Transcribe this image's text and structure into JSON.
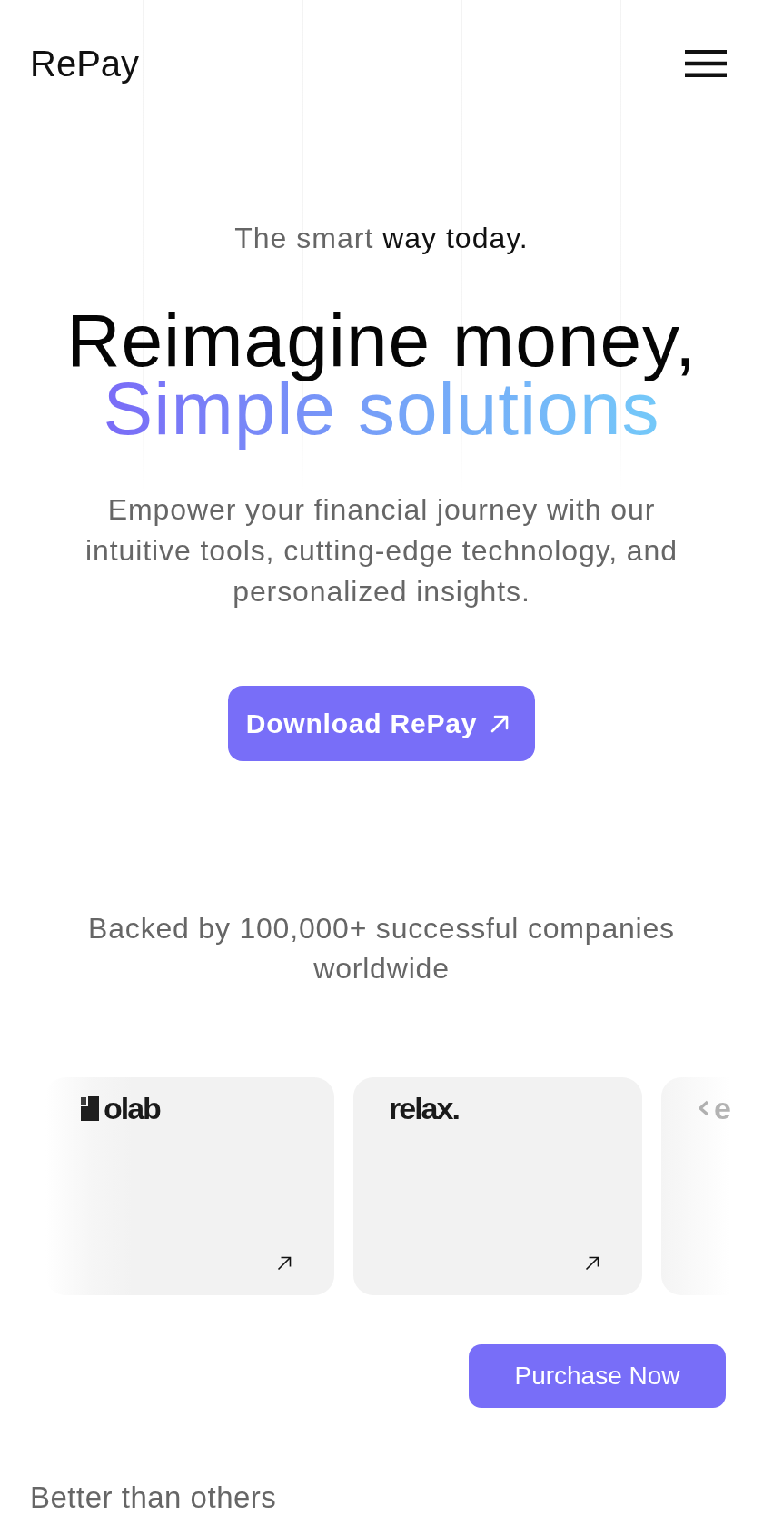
{
  "header": {
    "logo": "RePay"
  },
  "hero": {
    "tagline": [
      {
        "text": "The smart",
        "emphasis": false
      },
      {
        "text": "way today.",
        "emphasis": true
      }
    ],
    "headline": [
      {
        "text": "Reimagine money,",
        "gradient": false
      },
      {
        "text": "Simple solutions",
        "gradient": true
      }
    ],
    "description": "Empower your financial journey with our intuitive tools, cutting-edge technology, and personalized insights.",
    "cta": {
      "label": "Download RePay"
    }
  },
  "partners": {
    "heading": "Backed by 100,000+ successful companies worldwide",
    "cards": [
      {
        "kind": "full",
        "logo": {
          "kind": "block-mark",
          "text": "olab"
        }
      },
      {
        "kind": "full",
        "logo": {
          "kind": "wordmark",
          "text": "relax."
        }
      },
      {
        "kind": "peek",
        "logo": {
          "kind": "chevron-mark",
          "text": "e"
        }
      }
    ]
  },
  "purchase_button": {
    "label": "Purchase Now"
  },
  "section_title": "Better than others"
}
